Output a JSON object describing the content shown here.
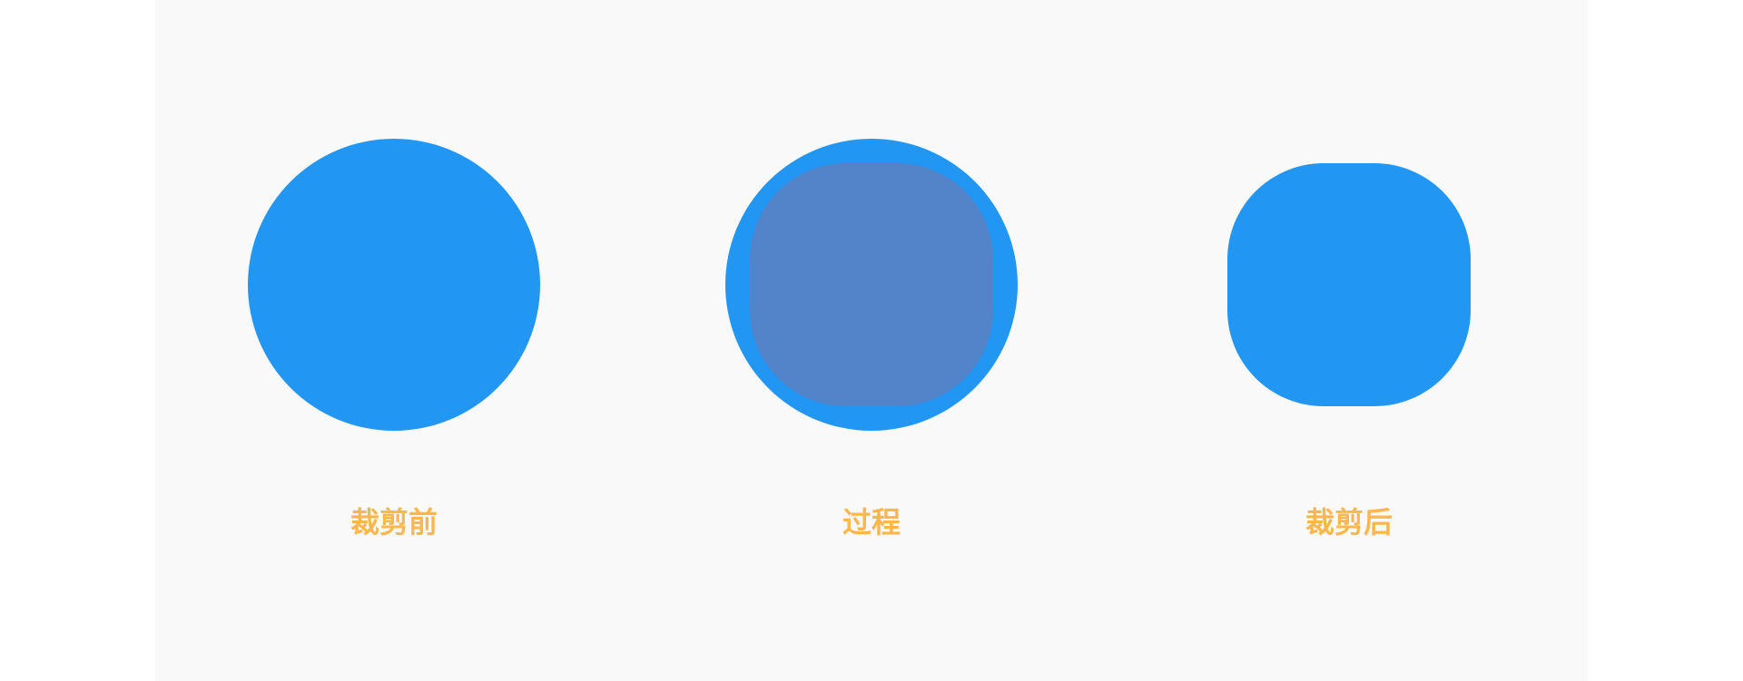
{
  "colors": {
    "background": "#ffffff",
    "panel": "#f9f9f9",
    "shape_fill": "#2196f3",
    "overlay_fill": "#5383c9",
    "label": "#ffb74d"
  },
  "stages": [
    {
      "label": "裁剪前"
    },
    {
      "label": "过程"
    },
    {
      "label": "裁剪后"
    }
  ]
}
